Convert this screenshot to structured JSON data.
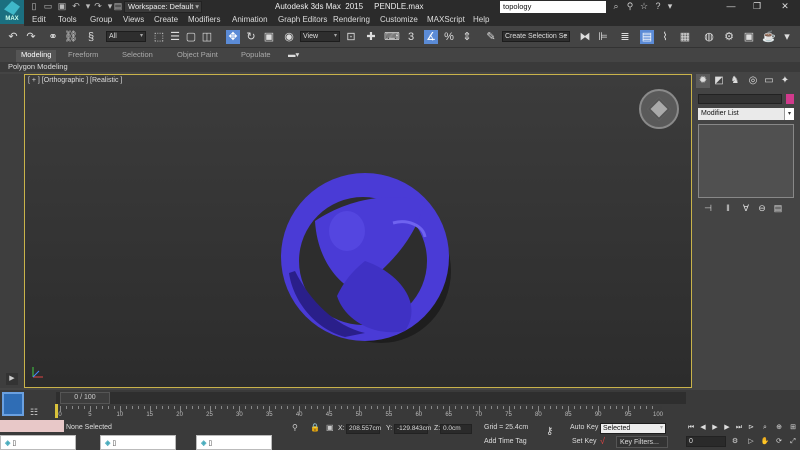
{
  "title_bar": {
    "logo_text": "MAX",
    "workspace_label": "Workspace: Default",
    "app_title": "Autodesk 3ds Max  2015     PENDLE.max",
    "search_value": "topology",
    "win_minimize": "—",
    "win_restore": "❐",
    "win_close": "✕"
  },
  "menu": {
    "items": [
      "Edit",
      "Tools",
      "Group",
      "Views",
      "Create",
      "Modifiers",
      "Animation",
      "Graph Editors",
      "Rendering",
      "Customize",
      "MAXScript",
      "Help"
    ]
  },
  "main_toolbar": {
    "selection_filter": "All",
    "ref_coord": "View",
    "snaps_label": "3",
    "named_sel": "Create Selection Se"
  },
  "ribbon": {
    "tabs": [
      "Modeling",
      "Freeform",
      "Selection",
      "Object Paint",
      "Populate"
    ],
    "active_tab": "Modeling",
    "sub_label": "Polygon Modeling"
  },
  "viewport": {
    "label": "[ + ] [Orthographic ] [Realistic ]",
    "object_color": "#4a3bd6",
    "border_color": "#c9b34a"
  },
  "command_panel": {
    "modifier_list_label": "Modifier List",
    "object_color_swatch": "#d13a8c"
  },
  "timeline": {
    "slider_label": "0 / 100",
    "ticks": [
      "0",
      "5",
      "10",
      "15",
      "20",
      "25",
      "30",
      "35",
      "40",
      "45",
      "50",
      "55",
      "60",
      "65",
      "70",
      "75",
      "80",
      "85",
      "90",
      "95",
      "100"
    ]
  },
  "status": {
    "selection_text": "None Selected",
    "x_label": "X:",
    "x_value": "208.557cm",
    "y_label": "Y:",
    "y_value": "-129.843cm",
    "z_label": "Z:",
    "z_value": "0.0cm",
    "grid": "Grid = 25.4cm",
    "add_time_tag": "Add Time Tag",
    "auto_key": "Auto Key",
    "set_key": "Set Key",
    "key_mode_value": "Selected",
    "key_filters": "Key Filters...",
    "frame_value": "0"
  }
}
